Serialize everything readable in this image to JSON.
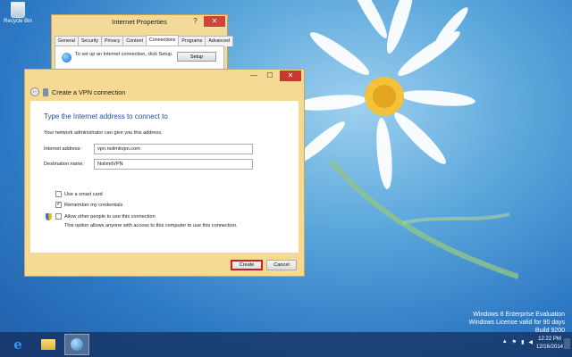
{
  "desktop": {
    "recycle_bin_label": "Recycle Bin",
    "watermark": {
      "line1": "Windows 8 Enterprise Evaluation",
      "line2": "Windows License valid for 90 days",
      "line3": "Build 9200"
    }
  },
  "internet_properties": {
    "title": "Internet Properties",
    "help_glyph": "?",
    "minimize_glyph": "_",
    "close_glyph": "✕",
    "tabs": [
      "General",
      "Security",
      "Privacy",
      "Content",
      "Connections",
      "Programs",
      "Advanced"
    ],
    "active_tab": "Connections",
    "setup_text": "To set up an Internet connection, click Setup.",
    "setup_button": "Setup"
  },
  "vpn_wizard": {
    "title": "Create a VPN connection",
    "minimize_glyph": "—",
    "maximize_glyph": "☐",
    "close_glyph": "✕",
    "back_glyph": "←",
    "heading": "Type the Internet address to connect to",
    "subtext": "Your network administrator can give you this address.",
    "internet_address_label": "Internet address:",
    "internet_address_value": "vpn.nolimitvpn.com",
    "destination_name_label": "Destination name:",
    "destination_name_value": "NolimitVPN",
    "smart_card_label": "Use a smart card",
    "smart_card_checked": false,
    "remember_label": "Remember my credentials",
    "remember_checked": true,
    "allow_others_label": "Allow other people to use this connection",
    "allow_others_checked": false,
    "allow_others_desc": "This option allows anyone with access to this computer to use this connection.",
    "check_glyph": "✓",
    "create_button": "Create",
    "cancel_button": "Cancel"
  },
  "taskbar": {
    "ie_glyph": "e",
    "tray_up_glyph": "▲",
    "tray_flag_glyph": "⚑",
    "tray_network_glyph": "▮",
    "tray_volume_glyph": "◀",
    "time": "12:22 PM",
    "date": "12/16/2014"
  },
  "colors": {
    "window_frame": "#f6d993",
    "heading_blue": "#1a4f9c",
    "highlight_red": "#cf1b2b",
    "close_red": "#c6392f"
  }
}
